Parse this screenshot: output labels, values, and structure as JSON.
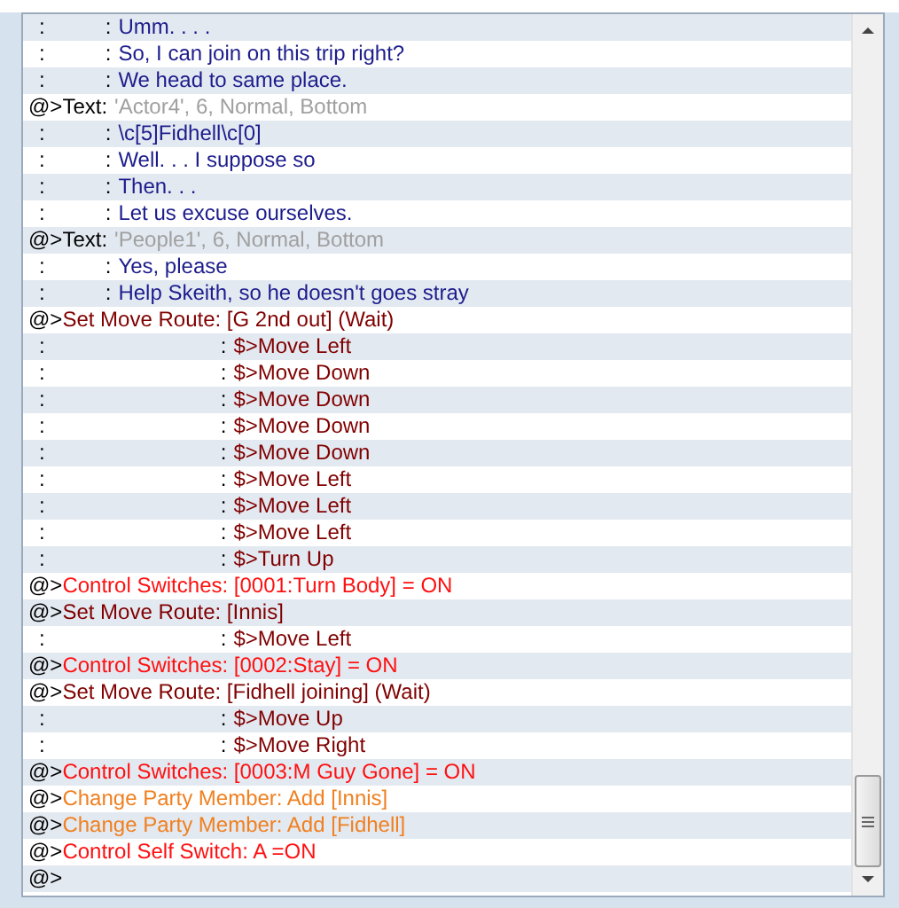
{
  "event_list": {
    "rows": [
      {
        "kind": "message",
        "marker": ":",
        "separator": ":",
        "text": "Umm. . . ."
      },
      {
        "kind": "message",
        "marker": ":",
        "separator": ":",
        "text": "So, I can join on this trip right?"
      },
      {
        "kind": "message",
        "marker": ":",
        "separator": ":",
        "text": "We head to same place."
      },
      {
        "kind": "text",
        "marker": "@>",
        "label": "Text:",
        "text": "'Actor4', 6, Normal, Bottom"
      },
      {
        "kind": "message",
        "marker": ":",
        "separator": ":",
        "text": "\\c[5]Fidhell\\c[0]"
      },
      {
        "kind": "message",
        "marker": ":",
        "separator": ":",
        "text": "Well. . . I suppose so"
      },
      {
        "kind": "message",
        "marker": ":",
        "separator": ":",
        "text": "Then. . ."
      },
      {
        "kind": "message",
        "marker": ":",
        "separator": ":",
        "text": "Let us excuse ourselves."
      },
      {
        "kind": "text",
        "marker": "@>",
        "label": "Text:",
        "text": "'People1', 6, Normal, Bottom"
      },
      {
        "kind": "message",
        "marker": ":",
        "separator": ":",
        "text": "Yes, please"
      },
      {
        "kind": "message",
        "marker": ":",
        "separator": ":",
        "text": "Help Skeith, so he doesn't goes stray"
      },
      {
        "kind": "move_route",
        "marker": "@>",
        "text": "Set Move Route: [G 2nd out] (Wait)"
      },
      {
        "kind": "route_step",
        "marker": ":",
        "separator": ":",
        "text": "$>Move Left"
      },
      {
        "kind": "route_step",
        "marker": ":",
        "separator": ":",
        "text": "$>Move Down"
      },
      {
        "kind": "route_step",
        "marker": ":",
        "separator": ":",
        "text": "$>Move Down"
      },
      {
        "kind": "route_step",
        "marker": ":",
        "separator": ":",
        "text": "$>Move Down"
      },
      {
        "kind": "route_step",
        "marker": ":",
        "separator": ":",
        "text": "$>Move Down"
      },
      {
        "kind": "route_step",
        "marker": ":",
        "separator": ":",
        "text": "$>Move Left"
      },
      {
        "kind": "route_step",
        "marker": ":",
        "separator": ":",
        "text": "$>Move Left"
      },
      {
        "kind": "route_step",
        "marker": ":",
        "separator": ":",
        "text": "$>Move Left"
      },
      {
        "kind": "route_step",
        "marker": ":",
        "separator": ":",
        "text": "$>Turn Up"
      },
      {
        "kind": "switch",
        "marker": "@>",
        "text": "Control Switches: [0001:Turn Body] = ON"
      },
      {
        "kind": "move_route",
        "marker": "@>",
        "text": "Set Move Route: [Innis]"
      },
      {
        "kind": "route_step",
        "marker": ":",
        "separator": ":",
        "text": "$>Move Left"
      },
      {
        "kind": "switch",
        "marker": "@>",
        "text": "Control Switches: [0002:Stay] = ON"
      },
      {
        "kind": "move_route",
        "marker": "@>",
        "text": "Set Move Route: [Fidhell joining] (Wait)"
      },
      {
        "kind": "route_step",
        "marker": ":",
        "separator": ":",
        "text": "$>Move Up"
      },
      {
        "kind": "route_step",
        "marker": ":",
        "separator": ":",
        "text": "$>Move Right"
      },
      {
        "kind": "switch",
        "marker": "@>",
        "text": "Control Switches: [0003:M Guy Gone] = ON"
      },
      {
        "kind": "party",
        "marker": "@>",
        "text": "Change Party Member: Add [Innis]"
      },
      {
        "kind": "party",
        "marker": "@>",
        "text": "Change Party Member: Add [Fidhell]"
      },
      {
        "kind": "switch",
        "marker": "@>",
        "text": "Control Self Switch: A =ON"
      },
      {
        "kind": "end",
        "marker": "@>"
      }
    ]
  }
}
